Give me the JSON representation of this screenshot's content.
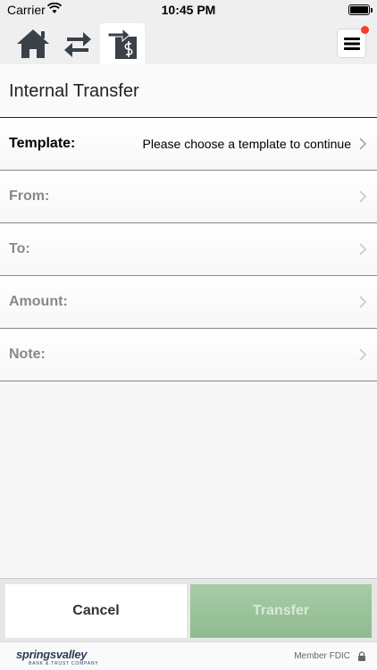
{
  "status_bar": {
    "carrier": "Carrier",
    "time": "10:45 PM"
  },
  "nav": {
    "home_icon": "home-icon",
    "switch_icon": "arrows-switch-icon",
    "transfer_icon": "transfer-dollar-icon",
    "menu_icon": "hamburger-menu-icon",
    "badge_color": "#ff3b30"
  },
  "page": {
    "title": "Internal Transfer"
  },
  "form": {
    "template": {
      "label": "Template:",
      "value": "Please choose a template to continue"
    },
    "from": {
      "label": "From:",
      "value": ""
    },
    "to": {
      "label": "To:",
      "value": ""
    },
    "amount": {
      "label": "Amount:",
      "value": ""
    },
    "note": {
      "label": "Note:",
      "value": ""
    }
  },
  "actions": {
    "cancel_label": "Cancel",
    "transfer_label": "Transfer",
    "transfer_color": "#9ec49e"
  },
  "footer": {
    "logo_text": "springsvalley",
    "logo_subtext": "BANK & TRUST COMPANY",
    "member_text": "Member FDIC"
  }
}
